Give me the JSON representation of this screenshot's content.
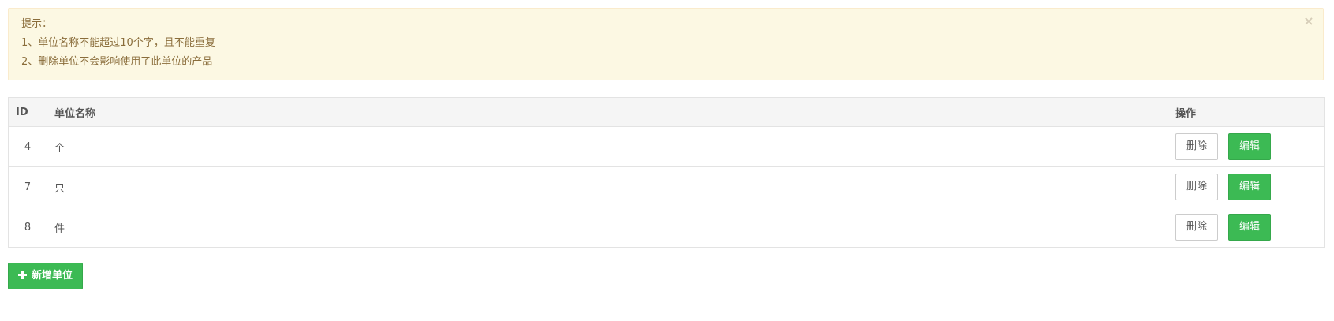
{
  "alert": {
    "title": "提示：",
    "lines": [
      "1、单位名称不能超过10个字，且不能重复",
      "2、删除单位不会影响使用了此单位的产品"
    ],
    "close": "×"
  },
  "table": {
    "headers": {
      "id": "ID",
      "name": "单位名称",
      "op": "操作"
    },
    "rows": [
      {
        "id": "4",
        "name": "个",
        "delete": "删除",
        "edit": "编辑"
      },
      {
        "id": "7",
        "name": "只",
        "delete": "删除",
        "edit": "编辑"
      },
      {
        "id": "8",
        "name": "件",
        "delete": "删除",
        "edit": "编辑"
      }
    ]
  },
  "actions": {
    "add_label": "新增单位",
    "add_icon": "plus-icon"
  },
  "colors": {
    "alert_bg": "#fcf8e3",
    "alert_text": "#8a6d3b",
    "success": "#3cba54",
    "header_bg": "#f5f5f5"
  }
}
